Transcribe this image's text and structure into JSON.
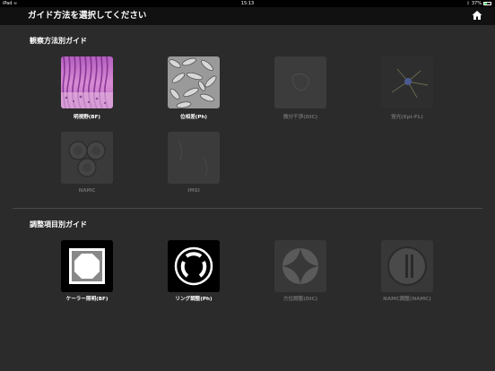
{
  "status_bar": {
    "device": "iPad",
    "time": "15:13",
    "battery": "37%",
    "battery_level": 0.37
  },
  "nav": {
    "title": "ガイド方法を選択してください",
    "home_icon": "home-icon"
  },
  "sections": {
    "observation": {
      "title": "観察方法別ガイド",
      "items": [
        {
          "label": "明視野(BF)",
          "enabled": true
        },
        {
          "label": "位相差(Ph)",
          "enabled": true
        },
        {
          "label": "微分干渉(DIC)",
          "enabled": false
        },
        {
          "label": "蛍光(Epi-FL)",
          "enabled": false
        },
        {
          "label": "NAMC",
          "enabled": false
        },
        {
          "label": "IMSI",
          "enabled": false
        }
      ]
    },
    "adjustment": {
      "title": "調整項目別ガイド",
      "items": [
        {
          "label": "ケーラー照明(BF)",
          "enabled": true
        },
        {
          "label": "リング調整(Ph)",
          "enabled": true
        },
        {
          "label": "方位調整(DIC)",
          "enabled": false
        },
        {
          "label": "NAMC調整(NAMC)",
          "enabled": false
        }
      ]
    }
  },
  "colors": {
    "background": "#2b2b2b",
    "navbar": "#111111",
    "enabled_text": "#ffffff",
    "disabled_text": "#6a6a6a"
  }
}
